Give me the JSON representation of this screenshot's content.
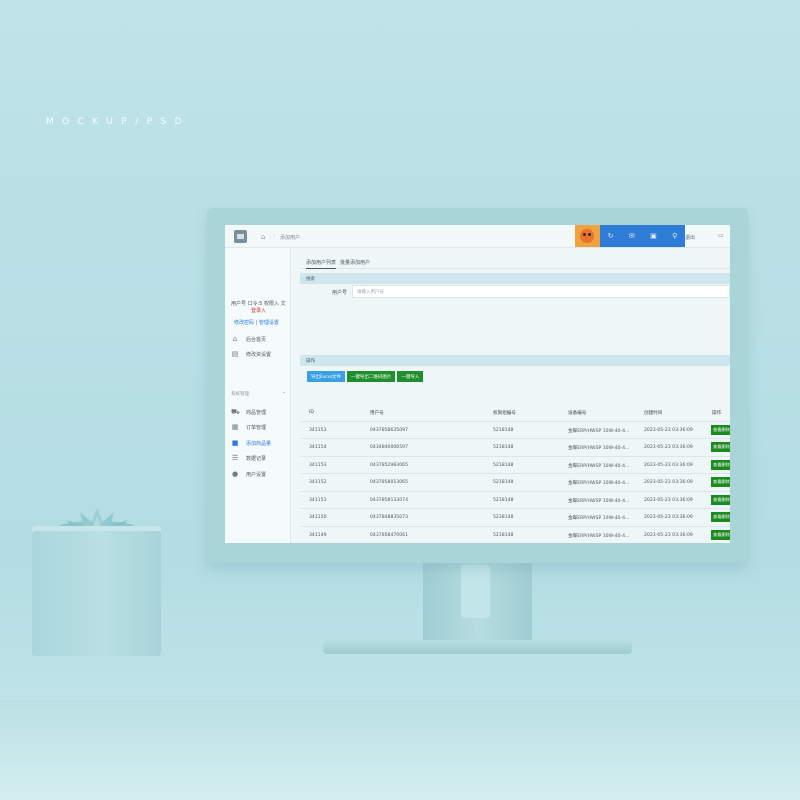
{
  "poster": {
    "label": "MOCKUP/PSD"
  },
  "topbar": {
    "breadcrumb": "添加用户",
    "right_text": "退出",
    "avatar_alt": "avatar"
  },
  "sidebar": {
    "user_line1": "用户号 口令:5 权限入 文",
    "user_line2": "登录入",
    "user_links": "修改密码 | 管理设置",
    "items_top": [
      {
        "icon": "home-icon",
        "label": "后台首页"
      },
      {
        "icon": "document-icon",
        "label": "修改资设置"
      }
    ],
    "section_label": "系统管理",
    "items_sub": [
      {
        "icon": "cart-icon",
        "label": "商品管理",
        "active": false
      },
      {
        "icon": "list-icon",
        "label": "订单管理",
        "active": false
      },
      {
        "icon": "box-icon",
        "label": "添加商品量",
        "active": true
      },
      {
        "icon": "table-icon",
        "label": "数据记录",
        "active": false
      },
      {
        "icon": "user-icon",
        "label": "用户设置",
        "active": false
      }
    ]
  },
  "main": {
    "tabs": [
      "添加用户列表",
      "批量添加用户"
    ],
    "filter_panel_title": "搜索",
    "filter_label": "用户号",
    "filter_placeholder": "请输入用户号",
    "actions_panel_title": "操作",
    "buttons": [
      {
        "label": "导出Excel文件",
        "color": "blue"
      },
      {
        "label": "一键导出二维码图片",
        "color": "green"
      },
      {
        "label": "一键导入",
        "color": "green"
      }
    ],
    "table": {
      "headers": [
        "ID",
        "用户号",
        "权限组编号",
        "设备编号",
        "创建时间",
        "操作"
      ],
      "rows": [
        {
          "id": "341153",
          "code": "0437858635097",
          "group": "5218148",
          "device": "金蝶ERP/HWSP 10W-40-4...",
          "time": "2023-05-23 03:36:09",
          "action": "查看删除"
        },
        {
          "id": "341154",
          "code": "0434840006597",
          "group": "5218148",
          "device": "金蝶ERP/HWSP 10W-40-4...",
          "time": "2023-05-23 03:36:09",
          "action": "查看删除"
        },
        {
          "id": "341153",
          "code": "0437852983065",
          "group": "5218148",
          "device": "金蝶ERP/HWSP 10W-40-4...",
          "time": "2023-05-23 03:36:09",
          "action": "查看删除"
        },
        {
          "id": "341152",
          "code": "0437858013065",
          "group": "5218148",
          "device": "金蝶ERP/HWSP 10W-40-4...",
          "time": "2023-05-23 03:36:09",
          "action": "查看删除"
        },
        {
          "id": "341151",
          "code": "0437858133074",
          "group": "5218148",
          "device": "金蝶ERP/HWSP 10W-40-4...",
          "time": "2023-05-23 03:36:09",
          "action": "查看删除"
        },
        {
          "id": "341150",
          "code": "0437848835073",
          "group": "5218148",
          "device": "金蝶ERP/HWSP 10W-40-4...",
          "time": "2023-05-23 03:36:09",
          "action": "查看删除"
        },
        {
          "id": "341149",
          "code": "0437858470061",
          "group": "5218148",
          "device": "金蝶ERP/HWSP 10W-40-4...",
          "time": "2023-05-23 03:36:09",
          "action": "查看删除"
        },
        {
          "id": "341148",
          "code": "0437858375058",
          "group": "5218148",
          "device": "金蝶ERP/HWSP 10W-40-4...",
          "time": "2023-05-23 03:36:09",
          "action": "查看删除"
        },
        {
          "id": "341147",
          "code": "0436631279045",
          "group": "5218148",
          "device": "金蝶ERP/HWSP 10W-40-4...",
          "time": "2023-05-23 03:36:09",
          "action": "查看删除"
        }
      ]
    }
  },
  "colors": {
    "background": "#b3dde3",
    "accent_blue": "#2f7cd6",
    "button_green": "#1f8f2e",
    "button_blue": "#3aa0e6"
  }
}
